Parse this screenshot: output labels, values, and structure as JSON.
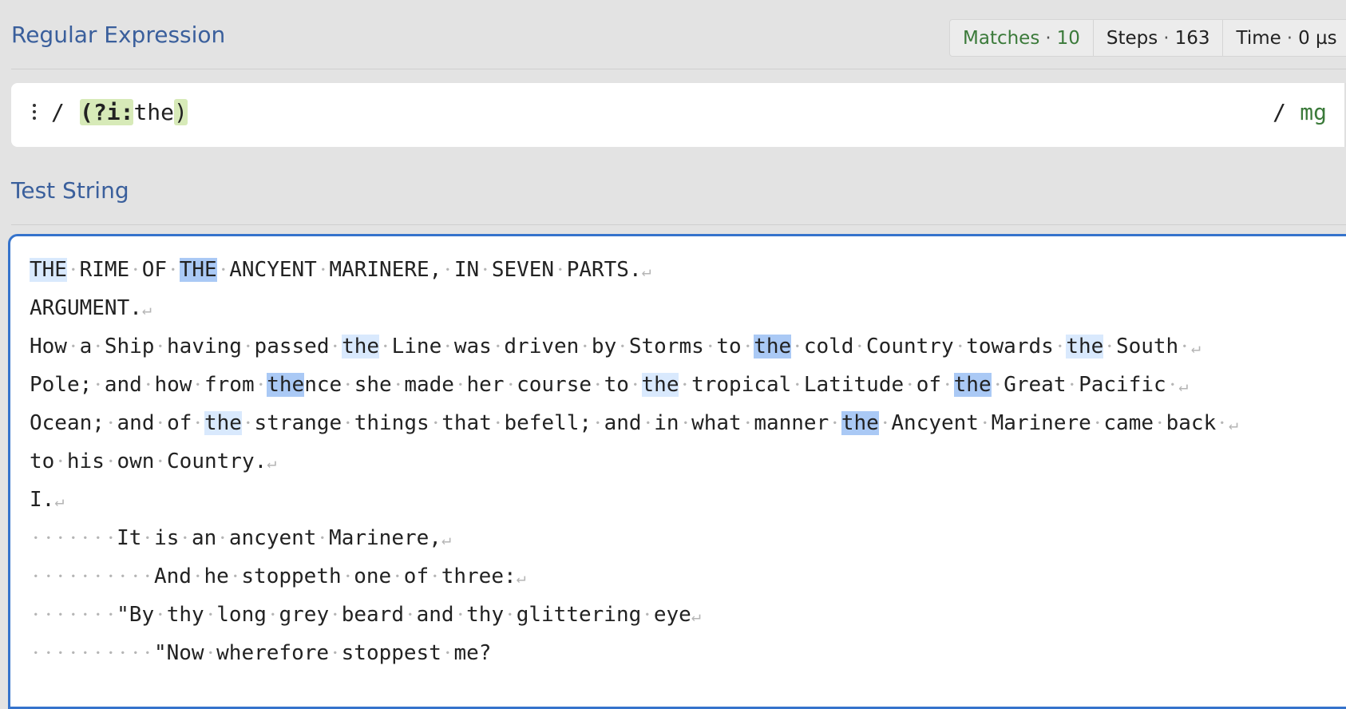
{
  "regex_section": {
    "title": "Regular Expression"
  },
  "stats": {
    "matches_label": "Matches",
    "matches_value": "10",
    "steps_label": "Steps",
    "steps_value": "163",
    "time_label": "Time",
    "time_value": "0 µs",
    "separator": "·"
  },
  "regex": {
    "open_delimiter": "/",
    "group_open": "(?i:",
    "pattern_text": "the",
    "group_close": ")",
    "close_delimiter": "/",
    "flags": "mg"
  },
  "test_section": {
    "title": "Test String"
  },
  "test_string": {
    "lines": [
      "THE RIME OF THE ANCYENT MARINERE, IN SEVEN PARTS.",
      "ARGUMENT.",
      "How a Ship having passed the Line was driven by Storms to the cold Country towards the South ",
      "Pole; and how from thence she made her course to the tropical Latitude of the Great Pacific ",
      "Ocean; and of the strange things that befell; and in what manner the Ancyent Marinere came back ",
      "to his own Country.",
      "I.",
      "       It is an ancyent Marinere,",
      "          And he stoppeth one of three:",
      "       \"By thy long grey beard and thy glittering eye",
      "          \"Now wherefore stoppest me?"
    ]
  },
  "colors": {
    "match_light": "#d9e9fd",
    "match_dark": "#aac9f5",
    "group_highlight": "#d7eab8",
    "title_blue": "#3a5f9c",
    "flags_green": "#3b7a3a",
    "focus_border": "#3573cc"
  },
  "icons": {
    "menu": "vertical-dots-icon"
  }
}
